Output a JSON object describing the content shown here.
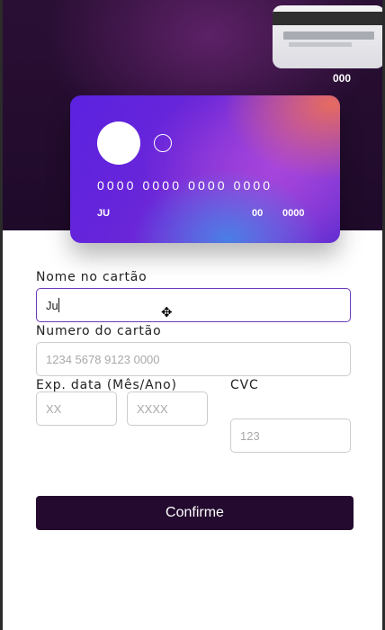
{
  "card_back": {
    "cvc": "000"
  },
  "card_front": {
    "number": "0000 0000 0000 0000",
    "name": "JU",
    "exp_month": "00",
    "exp_year": "0000"
  },
  "form": {
    "name_label": "Nome no cartão",
    "name_value": "Ju",
    "number_label": "Numero do cartão",
    "number_placeholder": "1234 5678 9123 0000",
    "exp_label": "Exp. data (Mês/Ano)",
    "month_placeholder": "XX",
    "year_placeholder": "XXXX",
    "cvc_label": "CVC",
    "cvc_placeholder": "123",
    "submit_label": "Confirme"
  },
  "colors": {
    "hero_background": "#230c2e",
    "button_background": "#240a2f",
    "active_input_border": "#6a3bb8"
  },
  "icons": {
    "cursor": "move-cursor-icon"
  }
}
